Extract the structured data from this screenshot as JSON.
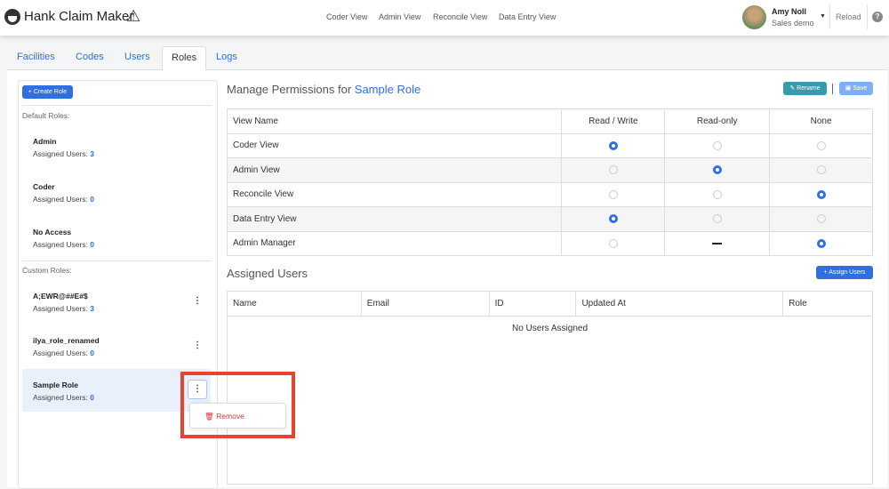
{
  "header": {
    "app_title": "Hank Claim Maker",
    "nav": [
      "Coder View",
      "Admin View",
      "Reconcile View",
      "Data Entry View"
    ],
    "user_name": "Amy Noll",
    "user_org": "Sales demo",
    "reload": "Reload",
    "help": "?"
  },
  "tabs": [
    "Facilities",
    "Codes",
    "Users",
    "Roles",
    "Logs"
  ],
  "sidebar": {
    "create_role": "+ Create Role",
    "default_label": "Default Roles:",
    "custom_label": "Custom Roles:",
    "assigned_label": "Assigned Users: ",
    "default_roles": [
      {
        "name": "Admin",
        "count": "3"
      },
      {
        "name": "Coder",
        "count": "0"
      },
      {
        "name": "No Access",
        "count": "0"
      }
    ],
    "custom_roles": [
      {
        "name": "A;EWR@##E#$",
        "count": "3"
      },
      {
        "name": "ilya_role_renamed",
        "count": "0"
      },
      {
        "name": "Sample Role",
        "count": "0"
      }
    ],
    "menu_remove": "Remove"
  },
  "permissions": {
    "title_prefix": "Manage Permissions for ",
    "role_name": "Sample Role",
    "rename": "Rename",
    "save": "Save",
    "columns": [
      "View Name",
      "Read / Write",
      "Read-only",
      "None"
    ],
    "rows": [
      {
        "view": "Coder View",
        "value": "rw"
      },
      {
        "view": "Admin View",
        "value": "ro"
      },
      {
        "view": "Reconcile View",
        "value": "none"
      },
      {
        "view": "Data Entry View",
        "value": "rw"
      },
      {
        "view": "Admin Manager",
        "value": "none",
        "ro_unavailable": true
      }
    ]
  },
  "assigned": {
    "title": "Assigned Users",
    "assign_button": "+ Assign Users",
    "columns": [
      "Name",
      "Email",
      "ID",
      "Updated At",
      "Role"
    ],
    "empty": "No Users Assigned"
  }
}
